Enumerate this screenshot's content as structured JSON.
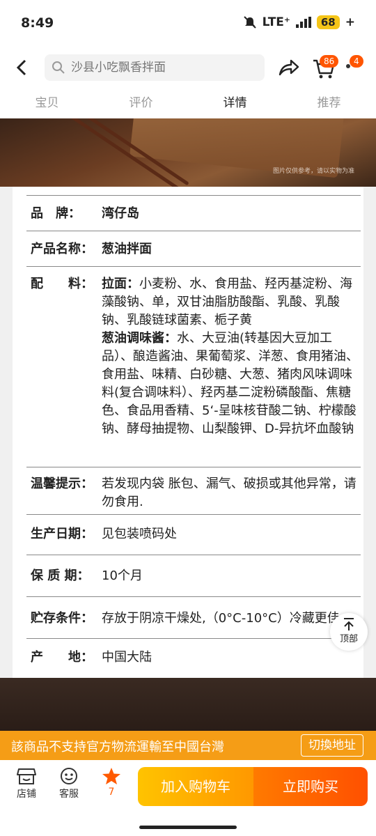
{
  "status_bar": {
    "time": "8:49",
    "network": "LTE⁺",
    "battery": "68"
  },
  "header": {
    "search_placeholder": "沙县小吃飘香拌面",
    "cart_count": "86",
    "more_count": "4"
  },
  "tabs": [
    {
      "label": "宝贝"
    },
    {
      "label": "评价"
    },
    {
      "label": "详情"
    },
    {
      "label": "推荐"
    }
  ],
  "hero": {
    "note": "图片仅供参考，请以实物为准"
  },
  "specs": {
    "brand": {
      "label": "品　牌：",
      "value": "湾仔岛"
    },
    "name": {
      "label": "产品名称：",
      "value": "葱油拌面"
    },
    "ingredients": {
      "label": "配　　料：",
      "noodle_title": "拉面：",
      "noodle_text": "小麦粉、水、食用盐、羟丙基淀粉、海藻酸钠、单，双甘油脂肪酸酯、乳酸、乳酸钠、乳酸链球菌素、栀子黄",
      "sauce_title": "葱油调味酱：",
      "sauce_text": "水、大豆油(转基因大豆加工品）、酿造酱油、果葡萄浆、洋葱、食用猪油、食用盐、味精、白砂糖、大葱、猪肉风味调味料(复合调味料）、羟丙基二淀粉磷酸酯、焦糖色、食品用香精、5‘-呈味核苷酸二钠、柠檬酸钠、酵母抽提物、山梨酸钾、D-异抗坏血酸钠"
    },
    "tips": {
      "label": "温馨提示：",
      "value": "若发现内袋 胀包、漏气、破损或其他异常，请勿食用."
    },
    "production_date": {
      "label": "生产日期：",
      "value": "见包装喷码处"
    },
    "shelf_life": {
      "label": "保 质 期：",
      "value": "10个月"
    },
    "storage": {
      "label": "贮存条件：",
      "value": "存放于阴凉干燥处,（0°C-10°C）冷藏更佳"
    },
    "origin": {
      "label": "产　　地：",
      "value": "中国大陆"
    }
  },
  "back_to_top": {
    "label": "顶部"
  },
  "notice": {
    "text": "該商品不支持官方物流運輸至中國台灣",
    "button": "切換地址"
  },
  "bottom_bar": {
    "shop_label": "店铺",
    "service_label": "客服",
    "favorite_count": "7",
    "add_to_cart": "加入购物车",
    "buy_now": "立即购买"
  },
  "colors": {
    "accent": "#ff5000",
    "notice_bg": "#f59d16",
    "favorite_star": "#ff5a00"
  }
}
